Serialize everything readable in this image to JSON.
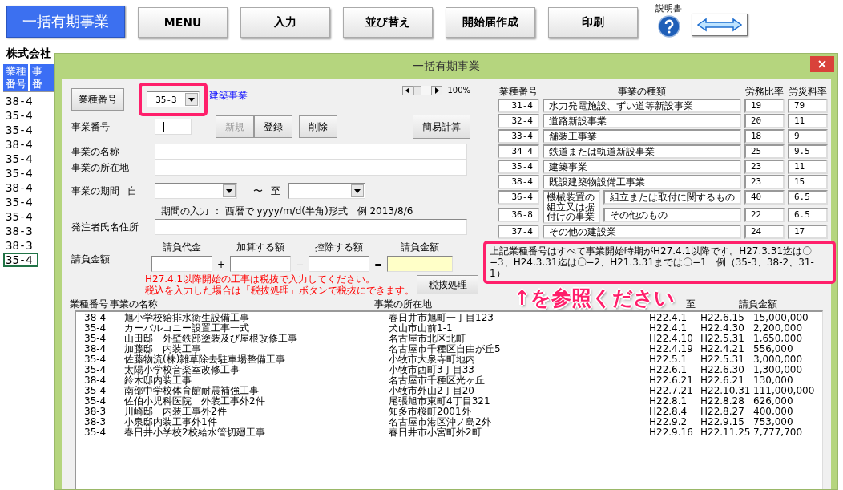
{
  "toolbar": {
    "app_title": "一括有期事業",
    "buttons": [
      "MENU",
      "入力",
      "並び替え",
      "開始届作成",
      "印刷"
    ],
    "help_label": "説明書"
  },
  "sheet": {
    "company": "株式会社",
    "columns": [
      {
        "lines": [
          "業種",
          "番号"
        ]
      },
      {
        "lines": [
          "事",
          "番"
        ]
      }
    ],
    "rows": [
      {
        "code": "38-4",
        "selected": false
      },
      {
        "code": "35-4",
        "selected": false
      },
      {
        "code": "35-4",
        "selected": false
      },
      {
        "code": "38-4",
        "selected": false
      },
      {
        "code": "35-4",
        "selected": false
      },
      {
        "code": "35-4",
        "selected": false
      },
      {
        "code": "38-4",
        "selected": false
      },
      {
        "code": "35-4",
        "selected": false
      },
      {
        "code": "35-4",
        "selected": false
      },
      {
        "code": "38-3",
        "selected": false
      },
      {
        "code": "38-3",
        "selected": false
      },
      {
        "code": "35-4",
        "selected": true
      }
    ]
  },
  "dialog": {
    "title": "一括有期事業",
    "type_button": "業種番号",
    "type_select": {
      "value": "35-3",
      "highlighted": true
    },
    "type_name": "建築事業",
    "zoom": "100%",
    "number_label": "事業番号",
    "action_buttons": [
      {
        "label": "新規",
        "disabled": true
      },
      {
        "label": "登録",
        "disabled": false
      },
      {
        "label": "削除",
        "disabled": false
      }
    ],
    "calc_button": "簡易計算",
    "name_label": "事業の名称",
    "location_label": "事業の所在地",
    "period": {
      "label": "事業の期間",
      "from": "自",
      "tilde": "〜",
      "to": "至",
      "note": "期間の入力 ： 西暦で yyyy/m/d(半角)形式　例 2013/8/6"
    },
    "orderer_label": "発注者氏名住所",
    "amount": {
      "label": "請負金額",
      "fields": [
        {
          "heading": "請負代金",
          "highlighted": false
        },
        {
          "heading": "加算する額",
          "highlighted": false
        },
        {
          "heading": "控除する額",
          "highlighted": false
        },
        {
          "heading": "請負金額",
          "highlighted": true
        }
      ],
      "operators": [
        "+",
        "−",
        "="
      ],
      "tax_note": [
        "H27.4.1以降開始の工事は税抜で入力してください。",
        "税込を入力した場合は「税抜処理」ボタンで税抜にできます。"
      ],
      "tax_button": "税抜処理"
    },
    "rates": {
      "headers": [
        "業種番号",
        "事業の種類",
        "労務比率",
        "労災料率"
      ],
      "rows": [
        {
          "kind": "single",
          "code": "31-4",
          "name": "水力発電施設、ずい道等新設事業",
          "ratio": "19",
          "rate": "79"
        },
        {
          "kind": "single",
          "code": "32-4",
          "name": "道路新設事業",
          "ratio": "20",
          "rate": "11"
        },
        {
          "kind": "single",
          "code": "33-4",
          "name": "舗装工事業",
          "ratio": "18",
          "rate": "9"
        },
        {
          "kind": "single",
          "code": "34-4",
          "name": "鉄道または軌道新設事業",
          "ratio": "25",
          "rate": "9.5"
        },
        {
          "kind": "single",
          "code": "35-4",
          "name": "建築事業",
          "ratio": "23",
          "rate": "11"
        },
        {
          "kind": "single",
          "code": "38-4",
          "name": "既設建築物設備工事業",
          "ratio": "23",
          "rate": "15"
        },
        {
          "kind": "group",
          "name": "機械装置の組立又は据付けの事業",
          "items": [
            {
              "code": "36-4",
              "name": "組立または取付に関するもの",
              "ratio": "40",
              "rate": "6.5"
            },
            {
              "code": "36-8",
              "name": "その他のもの",
              "ratio": "22",
              "rate": "6.5"
            }
          ]
        },
        {
          "kind": "single",
          "code": "37-4",
          "name": "その他の建設業",
          "ratio": "24",
          "rate": "17"
        }
      ],
      "notice": {
        "text": "上記業種番号はすべて事業開始時期がH27.4.1以降です。H27.3.31迄は〇−3、H24.3.31迄は〇−2、H21.3.31までは〇−1　例（35-3、38-2、31-1）",
        "highlighted": true
      }
    },
    "list": {
      "columns": [
        "業種番号",
        "事業の名称",
        "事業の所在地",
        null,
        "至",
        "請負金額"
      ],
      "rows": [
        [
          "38-4",
          "旭小学校給排水衛生設備工事",
          "春日井市旭町一丁目123",
          "H22.4.1",
          "H22.6.15",
          "15,000,000"
        ],
        [
          "35-4",
          "カーバルコニー設置工事一式",
          "犬山市山前1-1",
          "H22.4.1",
          "H22.4.30",
          "2,200,000"
        ],
        [
          "35-4",
          "山田邸　外壁鉄部塗装及び屋根改修工事",
          "名古屋市北区北町",
          "H22.4.10",
          "H22.5.31",
          "1,650,000"
        ],
        [
          "38-4",
          "加藤邸　内装工事",
          "名古屋市千種区自由が丘5",
          "H22.4.19",
          "H22.4.21",
          "556,000"
        ],
        [
          "35-4",
          "佐藤物流(株)雑草除去駐車場整備工事",
          "小牧市大泉寺町地内",
          "H22.5.1",
          "H22.5.31",
          "3,000,000"
        ],
        [
          "35-4",
          "太陽小学校音楽室改修工事",
          "小牧市西町3丁目33",
          "H22.6.1",
          "H22.6.30",
          "1,300,000"
        ],
        [
          "38-4",
          "鈴木邸内装工事",
          "名古屋市千種区光ヶ丘",
          "H22.6.21",
          "H22.6.21",
          "130,000"
        ],
        [
          "35-4",
          "南部中学校体育館耐震補強工事",
          "小牧市外山2丁目20",
          "H22.7.21",
          "H22.10.31",
          "111,000,000"
        ],
        [
          "35-4",
          "佐伯小児科医院　外装工事外2件",
          "尾張旭市東町4丁目321",
          "H22.8.1",
          "H22.8.28",
          "626,000"
        ],
        [
          "38-3",
          "川崎邸　内装工事外2件",
          "知多市桜町2001外",
          "H22.8.4",
          "H22.8.27",
          "400,000"
        ],
        [
          "38-3",
          "小泉邸内装工事外1件",
          "名古屋市港区沖ノ島2外",
          "H22.9.2",
          "H22.9.15",
          "753,000"
        ],
        [
          "35-4",
          "春日井小学校2校給水管切廻工事",
          "春日井市小宮町外2町",
          "H22.9.16",
          "H22.11.25",
          "7,777,700"
        ]
      ]
    },
    "annotation": "↑を参照ください"
  }
}
